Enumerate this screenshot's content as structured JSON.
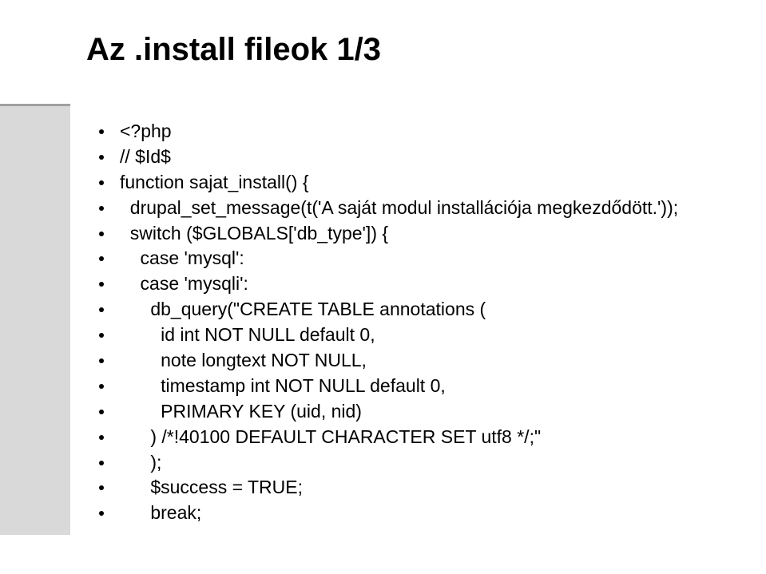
{
  "title": "Az .install fileok 1/3",
  "lines": [
    "<?php",
    "// $Id$",
    "function sajat_install() {",
    "  drupal_set_message(t('A saját modul installációja megkezdődött.'));",
    "  switch ($GLOBALS['db_type']) {",
    "    case 'mysql':",
    "    case 'mysqli':",
    "      db_query(\"CREATE TABLE annotations (",
    "        id int NOT NULL default 0,",
    "        note longtext NOT NULL,",
    "        timestamp int NOT NULL default 0,",
    "        PRIMARY KEY (uid, nid)",
    "      ) /*!40100 DEFAULT CHARACTER SET utf8 */;\"",
    "      );",
    "      $success = TRUE;",
    "      break;"
  ]
}
